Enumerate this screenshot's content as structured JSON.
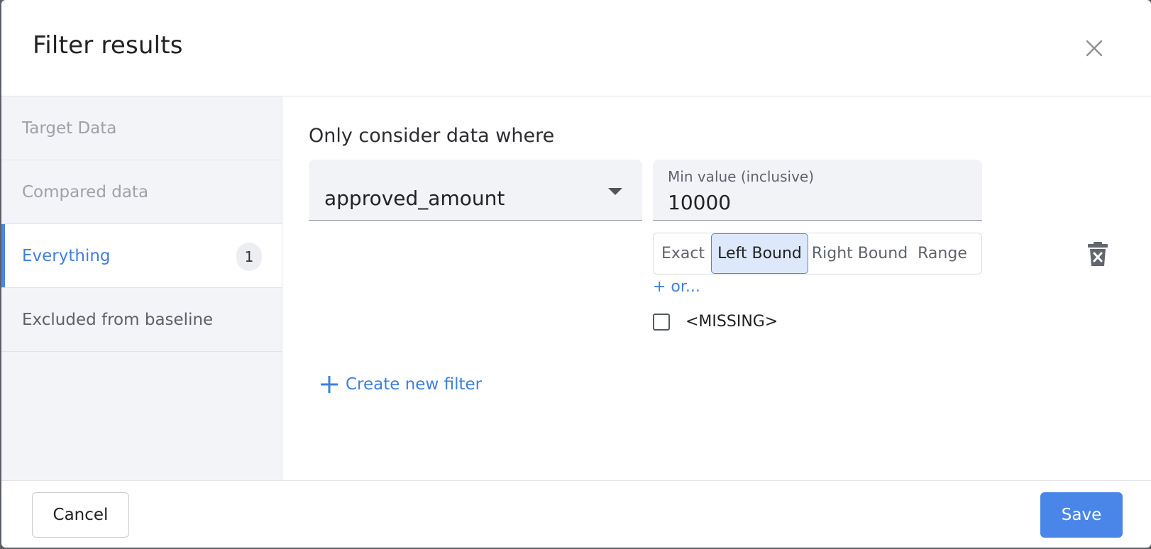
{
  "dialog": {
    "title": "Filter results",
    "close_icon": "close-icon"
  },
  "sidebar": {
    "items": [
      {
        "label": "Target Data",
        "state": "muted"
      },
      {
        "label": "Compared data",
        "state": "muted"
      },
      {
        "label": "Everything",
        "state": "active",
        "badge": "1"
      },
      {
        "label": "Excluded from baseline",
        "state": "normal"
      }
    ]
  },
  "main": {
    "heading": "Only consider data where",
    "field": {
      "value": "approved_amount"
    },
    "min_value": {
      "label": "Min value (inclusive)",
      "value": "10000"
    },
    "bound_options": [
      "Exact",
      "Left Bound",
      "Right Bound",
      "Range"
    ],
    "bound_selected": "Left Bound",
    "or_link": "+ or...",
    "missing": {
      "label": "<MISSING>",
      "checked": false
    },
    "create_filter": "Create new filter"
  },
  "footer": {
    "cancel_label": "Cancel",
    "save_label": "Save"
  },
  "colors": {
    "accent": "#4a86e8",
    "link": "#3f7fde",
    "sidebar_bg": "#f3f4f7",
    "field_bg": "#f2f3f7",
    "segment_selected_bg": "#dde9fa"
  }
}
